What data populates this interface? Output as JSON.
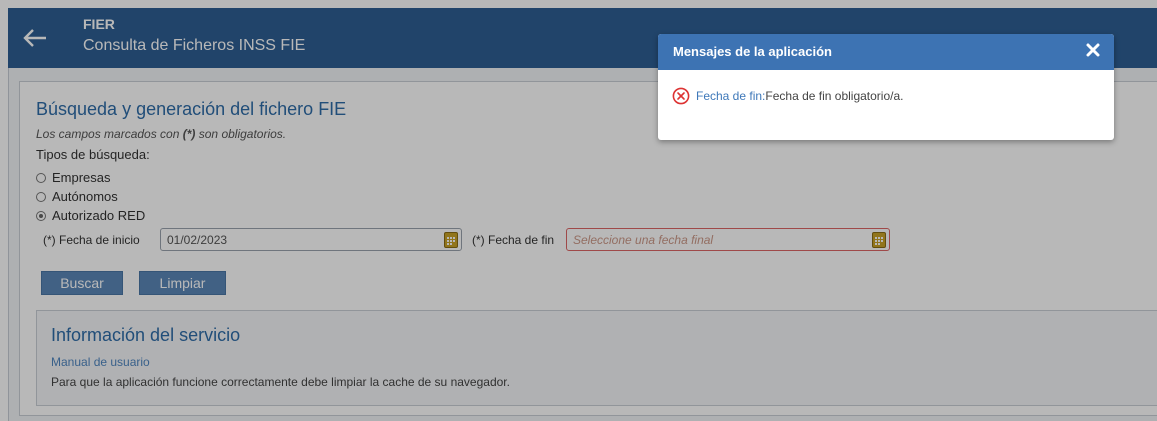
{
  "header": {
    "app_code": "FIER",
    "app_name": "Consulta de Ficheros INSS FIE",
    "back_icon": "arrow-left-icon"
  },
  "panel": {
    "title": "Búsqueda y generación del fichero FIE",
    "mandatory_prefix": "Los campos marcados con ",
    "mandatory_mark": "(*)",
    "mandatory_suffix": " son obligatorios.",
    "search_types_label": "Tipos de búsqueda:",
    "radios": [
      {
        "label": "Empresas",
        "checked": false
      },
      {
        "label": "Autónomos",
        "checked": false
      },
      {
        "label": "Autorizado RED",
        "checked": true
      }
    ],
    "start_date_label": "(*) Fecha de inicio",
    "start_date_value": "01/02/2023",
    "end_date_label": "(*) Fecha de fin",
    "end_date_placeholder": "Seleccione una fecha final",
    "search_button": "Buscar",
    "clear_button": "Limpiar"
  },
  "info": {
    "title": "Información del servicio",
    "manual_link": "Manual de usuario",
    "cache_note": "Para que la aplicación funcione correctamente debe limpiar la cache de su navegador."
  },
  "modal": {
    "title": "Mensajes de la aplicación",
    "close_icon": "close-icon",
    "error_icon": "error-circle-icon",
    "message_field": "Fecha de fin",
    "message_separator": ":",
    "message_text": " Fecha de fin obligatorio/a."
  },
  "colors": {
    "header_bg": "#2e5f94",
    "modal_header_bg": "#3d73b3",
    "accent_text": "#2f6ca8",
    "error": "#d33"
  }
}
